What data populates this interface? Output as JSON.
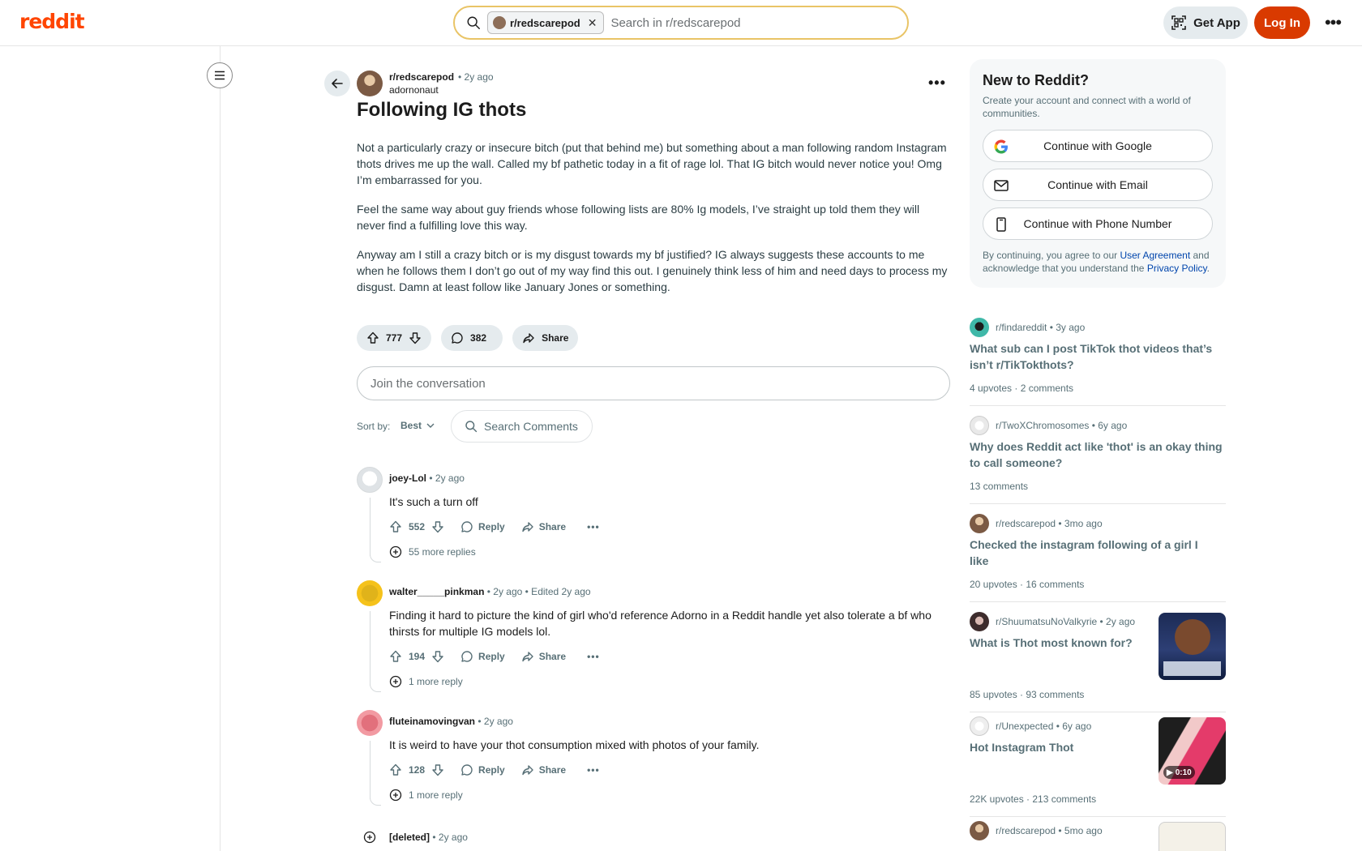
{
  "header": {
    "logo": "reddit",
    "search_chip": "r/redscarepod",
    "search_placeholder": "Search in r/redscarepod",
    "get_app": "Get App",
    "login": "Log In"
  },
  "post": {
    "subreddit": "r/redscarepod",
    "time": "• 2y ago",
    "author": "adornonaut",
    "title": "Following IG thots",
    "paragraphs": [
      "Not a particularly crazy or insecure bitch (put that behind me) but something about a man following random Instagram thots drives me up the wall. Called my bf pathetic today in a fit of rage lol. That IG bitch would never notice you! Omg I’m embarrassed for you.",
      "Feel the same way about guy friends whose following lists are 80% Ig models, I’ve straight up told them they will never find a fulfilling love this way.",
      "Anyway am I still a crazy bitch or is my disgust towards my bf justified? IG always suggests these accounts to me when he follows them I don’t go out of my way find this out. I genuinely think less of him and need days to process my disgust. Damn at least follow like January Jones or something."
    ],
    "votes": "777",
    "comments": "382",
    "share": "Share"
  },
  "join_placeholder": "Join the conversation",
  "sort": {
    "label": "Sort by:",
    "value": "Best",
    "search_comments": "Search Comments"
  },
  "comments": [
    {
      "user": "joey-Lol",
      "meta": "• 2y ago",
      "text": "It's such a turn off",
      "votes": "552",
      "reply": "Reply",
      "share": "Share",
      "more_replies": "55 more replies"
    },
    {
      "user": "walter_____pinkman",
      "meta": "• 2y ago • Edited 2y ago",
      "text": "Finding it hard to picture the kind of girl who'd reference Adorno in a Reddit handle yet also tolerate a bf who thirsts for multiple IG models lol.",
      "votes": "194",
      "reply": "Reply",
      "share": "Share",
      "more_replies": "1 more reply"
    },
    {
      "user": "fluteinamovingvan",
      "meta": "• 2y ago",
      "text": "It is weird to have your thot consumption mixed with photos of your family.",
      "votes": "128",
      "reply": "Reply",
      "share": "Share",
      "more_replies": "1 more reply"
    },
    {
      "user": "[deleted]",
      "meta": "• 2y ago"
    }
  ],
  "sidebar": {
    "new_title": "New to Reddit?",
    "new_sub": "Create your account and connect with a world of communities.",
    "google": "Continue with Google",
    "email": "Continue with Email",
    "phone": "Continue with Phone Number",
    "legal_a": "By continuing, you agree to our ",
    "legal_link1": "User Agreement",
    "legal_b": " and acknowledge that you understand the ",
    "legal_link2": "Privacy Policy",
    "legal_c": ".",
    "related": [
      {
        "sub": "r/findareddit",
        "time": "• 3y ago",
        "title": "What sub can I post TikTok thot videos that’s isn’t r/TikTokthots?",
        "stats": "4 upvotes  ·  2 comments"
      },
      {
        "sub": "r/TwoXChromosomes",
        "time": "• 6y ago",
        "title": "Why does Reddit act like 'thot' is an okay thing to call someone?",
        "stats": "13 comments"
      },
      {
        "sub": "r/redscarepod",
        "time": "• 3mo ago",
        "title": "Checked the instagram following of a girl I like",
        "stats": "20 upvotes  ·  16 comments"
      },
      {
        "sub": "r/ShuumatsuNoValkyrie",
        "time": "• 2y ago",
        "title": "What is Thot most known for?",
        "stats": "85 upvotes  ·  93 comments"
      },
      {
        "sub": "r/Unexpected",
        "time": "• 6y ago",
        "title": "Hot Instagram Thot",
        "stats": "22K upvotes  ·  213 comments",
        "duration": "0:10"
      },
      {
        "sub": "r/redscarepod",
        "time": "• 5mo ago"
      }
    ]
  }
}
